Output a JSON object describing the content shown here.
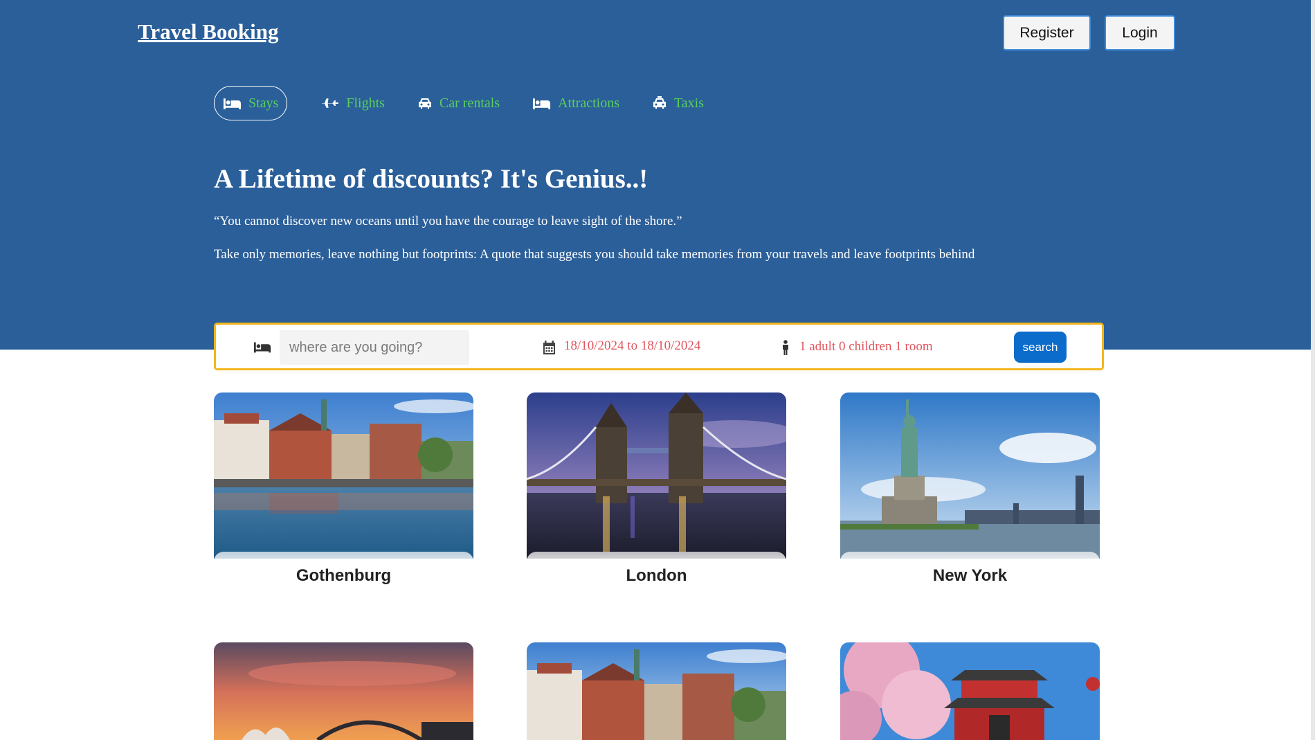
{
  "header": {
    "logo": "Travel Booking",
    "register_label": "Register",
    "login_label": "Login"
  },
  "nav": {
    "items": [
      {
        "label": "Stays",
        "icon": "bed-icon",
        "active": true
      },
      {
        "label": "Flights",
        "icon": "plane-icon",
        "active": false
      },
      {
        "label": "Car rentals",
        "icon": "car-icon",
        "active": false
      },
      {
        "label": "Attractions",
        "icon": "bed-icon",
        "active": false
      },
      {
        "label": "Taxis",
        "icon": "taxi-icon",
        "active": false
      }
    ]
  },
  "hero": {
    "headline": "A Lifetime of discounts? It's Genius..!",
    "quote": "“You cannot discover new oceans until you have the courage to leave sight of the shore.”",
    "tagline": "Take only memories, leave nothing but footprints: A quote that suggests you should take memories from your travels and leave footprints behind"
  },
  "search": {
    "destination_placeholder": "where are you going?",
    "destination_value": "",
    "dates": "18/10/2024 to 18/10/2024",
    "guests": "1 adult 0 children 1 room",
    "button_label": "search"
  },
  "destinations": [
    {
      "name": "Gothenburg",
      "image": "harbor-town"
    },
    {
      "name": "London",
      "image": "tower-bridge-night"
    },
    {
      "name": "New York",
      "image": "statue-of-liberty"
    },
    {
      "name": "",
      "image": "sydney-opera-house-sunset"
    },
    {
      "name": "",
      "image": "harbor-town"
    },
    {
      "name": "",
      "image": "japanese-temple-cherry-blossom"
    }
  ],
  "colors": {
    "hero_bg": "#2b5f99",
    "nav_text": "#57d05d",
    "search_border": "#f2b61c",
    "search_value_text": "#e0555e",
    "search_button": "#0b6ccb"
  }
}
